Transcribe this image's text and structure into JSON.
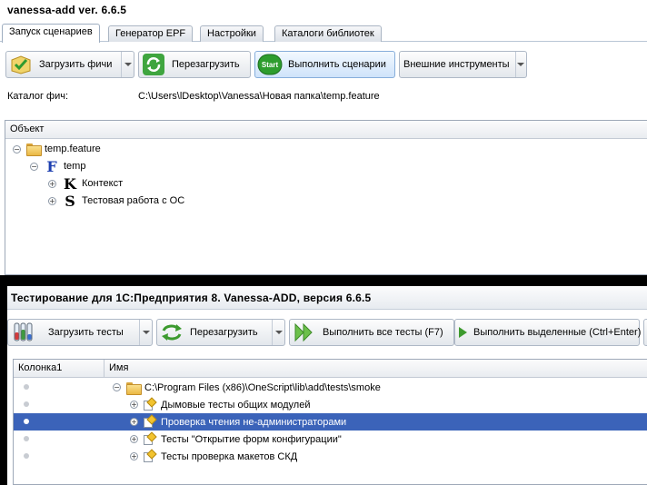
{
  "window1": {
    "title": "vanessa-add ver. 6.6.5",
    "tabs": [
      "Запуск сценариев",
      "Генератор EPF",
      "Настройки",
      "Каталоги библиотек"
    ],
    "toolbar": {
      "load_features": "Загрузить фичи",
      "reload": "Перезагрузить",
      "run_scenarios": "Выполнить сценарии",
      "external_tools": "Внешние инструменты",
      "start_badge": "Start"
    },
    "catalog_label": "Каталог фич:",
    "catalog_value": "C:\\Users\\lDesktop\\Vanessa\\Новая папка\\temp.feature",
    "tree_header": "Объект",
    "tree": {
      "root": "temp.feature",
      "feature": {
        "letter": "F",
        "label": "temp"
      },
      "context": {
        "letter": "K",
        "label": "Контекст"
      },
      "scenario": {
        "letter": "S",
        "label": "Тестовая работа с ОС"
      }
    }
  },
  "window2": {
    "title": "Тестирование для 1С:Предприятия 8. Vanessa-ADD, версия 6.6.5",
    "toolbar": {
      "load_tests": "Загрузить тесты",
      "reload": "Перезагрузить",
      "run_all": "Выполнить все тесты (F7)",
      "run_selected": "Выполнить выделенные (Ctrl+Enter)"
    },
    "columns": [
      "Колонка1",
      "Имя"
    ],
    "tree": {
      "root": "C:\\Program Files (x86)\\OneScript\\lib\\add\\tests\\smoke",
      "items": [
        "Дымовые тесты общих модулей",
        "Проверка чтения не-администраторами",
        "Тесты \"Открытие форм конфигурации\"",
        "Тесты проверка макетов СКД"
      ],
      "selected_index": 1
    }
  },
  "colors": {
    "selection": "#3b63b9",
    "button_highlight": "#cfe3fa",
    "start_green": "#2e9d2e"
  }
}
